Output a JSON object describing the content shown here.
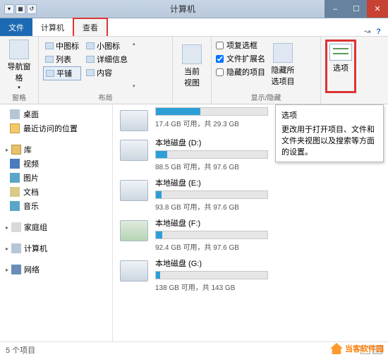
{
  "window": {
    "title": "计算机"
  },
  "tabs": {
    "file": "文件",
    "computer": "计算机",
    "view": "查看"
  },
  "ribbon": {
    "nav": {
      "label": "导航窗格",
      "group": "窗格"
    },
    "layout": {
      "medium": "中图标",
      "small": "小图标",
      "list": "列表",
      "details": "详细信息",
      "tiles": "平铺",
      "content": "内容",
      "group": "布局"
    },
    "current": {
      "label": "当前\n视图"
    },
    "show": {
      "checkboxes": "项复选框",
      "extensions": "文件扩展名",
      "hidden": "隐藏的项目",
      "hide_btn": "隐藏所\n选项目",
      "group": "显示/隐藏"
    },
    "options": "选项"
  },
  "tooltip": {
    "title": "选项",
    "body": "更改用于打开项目、文件和文件夹视图以及搜索等方面的设置。"
  },
  "sidebar": {
    "desktop": "桌面",
    "recent": "最近访问的位置",
    "libraries": "库",
    "videos": "视频",
    "pictures": "图片",
    "documents": "文档",
    "music": "音乐",
    "homegroup": "家庭组",
    "computer": "计算机",
    "network": "网络"
  },
  "drives": [
    {
      "name_prefix": "",
      "name": "",
      "free": "17.4 GB 可用，共 29.3 GB",
      "fill": 40
    },
    {
      "name": "本地磁盘 (D:)",
      "free": "88.5 GB 可用，共 97.6 GB",
      "fill": 10
    },
    {
      "name": "本地磁盘 (E:)",
      "free": "93.8 GB 可用，共 97.6 GB",
      "fill": 5
    },
    {
      "name": "本地磁盘 (F:)",
      "free": "92.4 GB 可用，共 97.6 GB",
      "fill": 6
    },
    {
      "name": "本地磁盘 (G:)",
      "free": "138 GB 可用，共 143 GB",
      "fill": 4
    }
  ],
  "status": {
    "count": "5 个项目"
  },
  "brand": "当客软件园"
}
